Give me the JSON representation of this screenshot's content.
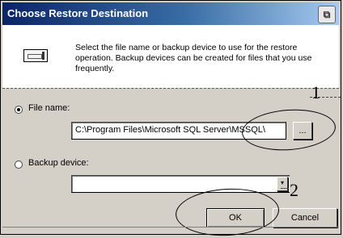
{
  "window": {
    "title": "Choose Restore Destination",
    "title_icon": "⧉"
  },
  "header": {
    "icon": "tape-device-icon",
    "description": "Select the file name or backup device to use for the restore operation.  Backup devices can be created for files that you use frequently."
  },
  "destination": {
    "file_name_label": "File name:",
    "file_name_value": "C:\\Program Files\\Microsoft SQL Server\\MSSQL\\",
    "browse_label": "...",
    "backup_device_label": "Backup device:",
    "backup_device_value": "",
    "selected": "file_name"
  },
  "buttons": {
    "ok": "OK",
    "cancel": "Cancel"
  },
  "annotations": {
    "callout_1": "1",
    "callout_2": "2"
  }
}
